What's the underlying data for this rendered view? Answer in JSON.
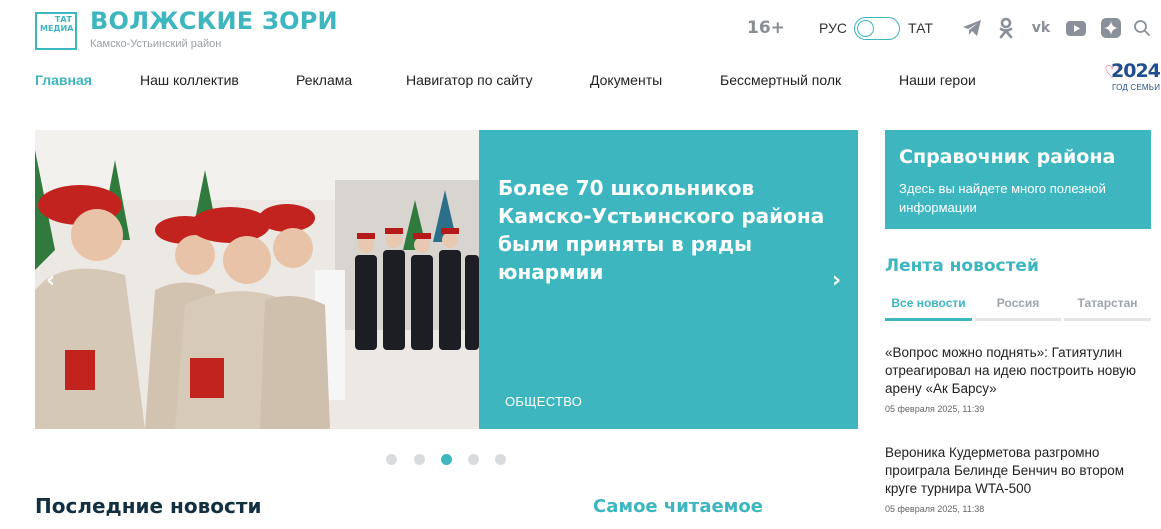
{
  "brand": {
    "logo_top": "ТАТ",
    "logo_bottom": "МЕДИА",
    "title": "ВОЛЖСКИЕ ЗОРИ",
    "subtitle": "Камско-Устьинский район",
    "accent_color": "#3db6c0"
  },
  "header": {
    "age_rating": "16+",
    "lang_left": "РУС",
    "lang_right": "ТАТ",
    "social_icons": [
      "telegram-icon",
      "odnoklassniki-icon",
      "vk-icon",
      "youtube-icon",
      "zen-icon",
      "search-icon"
    ]
  },
  "nav": {
    "items": [
      {
        "label": "Главная"
      },
      {
        "label": "Наш коллектив"
      },
      {
        "label": "Реклама"
      },
      {
        "label": "Навигатор по сайту"
      },
      {
        "label": "Документы"
      },
      {
        "label": "Бессмертный полк"
      },
      {
        "label": "Наши герои"
      }
    ],
    "active_index": 0
  },
  "year_badge": {
    "year": "2024",
    "caption": "ГОД СЕМЬИ"
  },
  "slider": {
    "title": "Более 70 школьников Камско-Устьинского района были приняты в ряды юнармии",
    "category": "ОБЩЕСТВО",
    "arrow_prev": "‹",
    "arrow_next": "›",
    "dots_count": 5,
    "active_dot": 2
  },
  "sections": {
    "latest": "Последние новости",
    "popular": "Самое читаемое"
  },
  "sidebar": {
    "guide_title": "Справочник района",
    "guide_text": "Здесь вы найдете много полезной информации",
    "feed_title": "Лента новостей",
    "tabs": [
      {
        "label": "Все новости"
      },
      {
        "label": "Россия"
      },
      {
        "label": "Татарстан"
      }
    ],
    "news": [
      {
        "text": "«Вопрос можно поднять»: Гатиятулин отреагировал на идею построить новую арену «Ак Барсу»",
        "date": "05 февраля 2025, 11:39"
      },
      {
        "text": "Вероника Кудерметова разгромно проиграла Белинде Бенчич во втором круге турнира WTA-500",
        "date": "05 февраля 2025, 11:38"
      }
    ]
  }
}
